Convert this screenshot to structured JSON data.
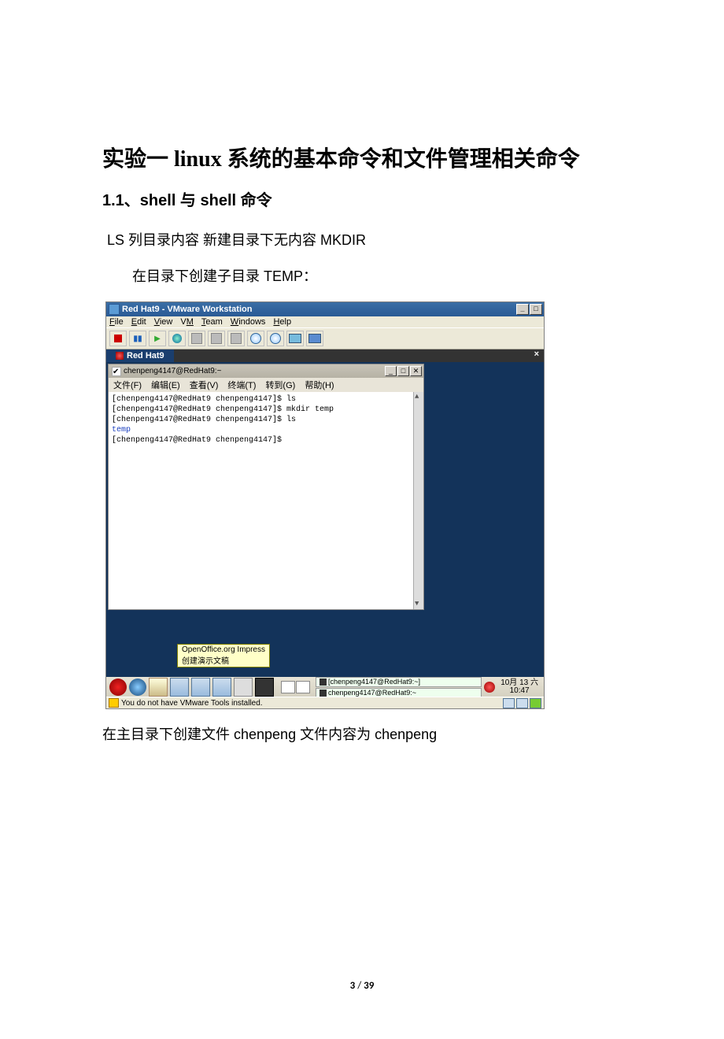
{
  "doc": {
    "title": "实验一  linux 系统的基本命令和文件管理相关命令",
    "subtitle": "1.1、shell 与 shell 命令",
    "para1": "LS 列目录内容  新建目录下无内容 MKDIR",
    "para2": "在目录下创建子目录  TEMP：",
    "para3": "在主目录下创建文件 chenpeng  文件内容为 chenpeng",
    "page_cur": "3",
    "page_sep": " / ",
    "page_total": "39"
  },
  "vm": {
    "app_title": "Red Hat9 - VMware Workstation",
    "menus": {
      "file": "File",
      "edit": "Edit",
      "view": "View",
      "vm": "VM",
      "team": "Team",
      "windows": "Windows",
      "help": "Help"
    },
    "tab": "Red Hat9",
    "status_msg": "You do not have VMware Tools installed."
  },
  "term": {
    "title": "chenpeng4147@RedHat9:~",
    "menus": {
      "file": "文件(F)",
      "edit": "编辑(E)",
      "view": "查看(V)",
      "terminal": "终端(T)",
      "go": "转到(G)",
      "help": "帮助(H)"
    },
    "lines": {
      "l1": "[chenpeng4147@RedHat9 chenpeng4147]$ ls",
      "l2": "[chenpeng4147@RedHat9 chenpeng4147]$ mkdir temp",
      "l3": "[chenpeng4147@RedHat9 chenpeng4147]$ ls",
      "l4": "temp",
      "l5": "[chenpeng4147@RedHat9 chenpeng4147]$"
    }
  },
  "tooltip": {
    "l1": "OpenOffice.org  Impress",
    "l2": "创建演示文稿"
  },
  "panel": {
    "task1": "[chenpeng4147@RedHat9:~]",
    "task2": "chenpeng4147@RedHat9:~",
    "date": "10月 13 六",
    "time": "10:47"
  }
}
